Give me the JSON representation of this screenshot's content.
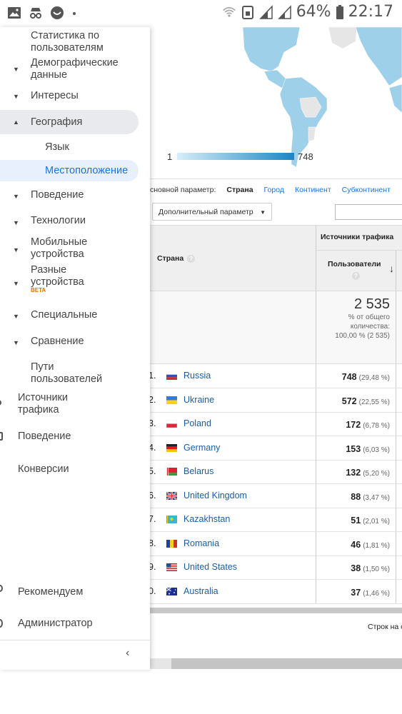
{
  "status_bar": {
    "battery_pct": "64%",
    "time": "22:17",
    "icons": [
      "image-icon",
      "incognito-icon",
      "smile-icon",
      "dot-icon",
      "wifi-icon",
      "sim-icon",
      "signal-icon",
      "battery-icon"
    ]
  },
  "sidebar": {
    "items": [
      {
        "label": "Статистика по пользователям"
      },
      {
        "label": "Демографические данные"
      },
      {
        "label": "Интересы"
      },
      {
        "label": "География"
      },
      {
        "label": "Язык"
      },
      {
        "label": "Местоположение"
      },
      {
        "label": "Поведение"
      },
      {
        "label": "Технологии"
      },
      {
        "label": "Мобильные устройства"
      },
      {
        "label": "Разные устройства",
        "badge": "BETA"
      },
      {
        "label": "Специальные"
      },
      {
        "label": "Сравнение"
      },
      {
        "label": "Пути пользователей"
      }
    ],
    "top_items": [
      {
        "label": "Источники трафика"
      },
      {
        "label": "Поведение"
      },
      {
        "label": "Конверсии"
      },
      {
        "label": "Рекомендуем"
      },
      {
        "label": "Администратор"
      }
    ],
    "collapse_icon": "chevron-left-icon"
  },
  "map": {
    "legend_min": "1",
    "legend_max": "748",
    "colors": {
      "low": "#d7eefa",
      "high": "#1b86c3",
      "land": "#e6e6e6"
    }
  },
  "dimensions": {
    "label": "сновной параметр:",
    "active": "Страна",
    "options": [
      "Город",
      "Континент",
      "Субконтинент"
    ]
  },
  "secondary_dimension": {
    "label": "Дополнительный параметр"
  },
  "table": {
    "country_header": "Страна",
    "group_header": "Источники трафика",
    "users_header": "Пользователи",
    "total_value": "2 535",
    "total_sub1": "% от общего",
    "total_sub2": "количества:",
    "total_sub3": "100,00 % (2 535)",
    "rows": [
      {
        "idx": "1.",
        "country": "Russia",
        "value": "748",
        "pct": "(29,48 %)",
        "flag": "ru"
      },
      {
        "idx": "2.",
        "country": "Ukraine",
        "value": "572",
        "pct": "(22,55 %)",
        "flag": "ua"
      },
      {
        "idx": "3.",
        "country": "Poland",
        "value": "172",
        "pct": "(6,78 %)",
        "flag": "pl"
      },
      {
        "idx": "4.",
        "country": "Germany",
        "value": "153",
        "pct": "(6,03 %)",
        "flag": "de"
      },
      {
        "idx": "5.",
        "country": "Belarus",
        "value": "132",
        "pct": "(5,20 %)",
        "flag": "by"
      },
      {
        "idx": "6.",
        "country": "United Kingdom",
        "value": "88",
        "pct": "(3,47 %)",
        "flag": "gb"
      },
      {
        "idx": "7.",
        "country": "Kazakhstan",
        "value": "51",
        "pct": "(2,01 %)",
        "flag": "kz"
      },
      {
        "idx": "8.",
        "country": "Romania",
        "value": "46",
        "pct": "(1,81 %)",
        "flag": "ro"
      },
      {
        "idx": "9.",
        "country": "United States",
        "value": "38",
        "pct": "(1,50 %)",
        "flag": "us"
      },
      {
        "idx": "0.",
        "country": "Australia",
        "value": "37",
        "pct": "(1,46 %)",
        "flag": "au"
      }
    ],
    "rows_per_page_label": "Строк на с"
  }
}
